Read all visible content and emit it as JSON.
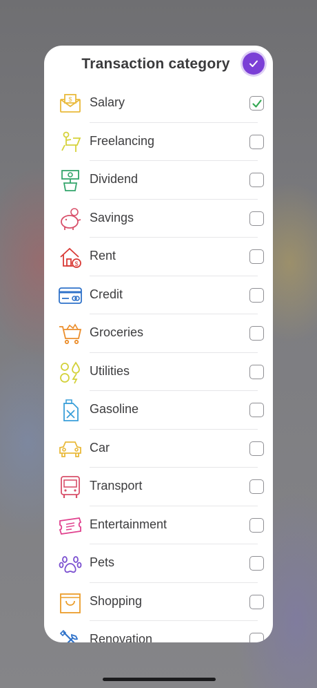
{
  "header": {
    "title": "Transaction category"
  },
  "items": [
    {
      "label": "Salary",
      "icon": "salary-envelope-icon",
      "color": "#e9b93a",
      "checked": true
    },
    {
      "label": "Freelancing",
      "icon": "freelancer-desk-icon",
      "color": "#d6d23a",
      "checked": false
    },
    {
      "label": "Dividend",
      "icon": "money-plant-icon",
      "color": "#33a56b",
      "checked": false
    },
    {
      "label": "Savings",
      "icon": "piggy-bank-icon",
      "color": "#d8506a",
      "checked": false
    },
    {
      "label": "Rent",
      "icon": "house-dollar-icon",
      "color": "#d93a36",
      "checked": false
    },
    {
      "label": "Credit",
      "icon": "credit-card-icon",
      "color": "#2f72c9",
      "checked": false
    },
    {
      "label": "Groceries",
      "icon": "shopping-cart-icon",
      "color": "#eb8d2a",
      "checked": false
    },
    {
      "label": "Utilities",
      "icon": "utilities-icon",
      "color": "#d3d13a",
      "checked": false
    },
    {
      "label": "Gasoline",
      "icon": "fuel-canister-icon",
      "color": "#3a9fd9",
      "checked": false
    },
    {
      "label": "Car",
      "icon": "car-icon",
      "color": "#e9b93a",
      "checked": false
    },
    {
      "label": "Transport",
      "icon": "bus-icon",
      "color": "#d8506a",
      "checked": false
    },
    {
      "label": "Entertainment",
      "icon": "ticket-icon",
      "color": "#e0418e",
      "checked": false
    },
    {
      "label": "Pets",
      "icon": "paw-icon",
      "color": "#7a4fd0",
      "checked": false
    },
    {
      "label": "Shopping",
      "icon": "shopping-bag-icon",
      "color": "#eb9d2a",
      "checked": false
    },
    {
      "label": "Renovation",
      "icon": "tools-icon",
      "color": "#2f72c9",
      "checked": false
    }
  ],
  "colors": {
    "accent": "#7b3fd6",
    "check": "#34a853"
  }
}
